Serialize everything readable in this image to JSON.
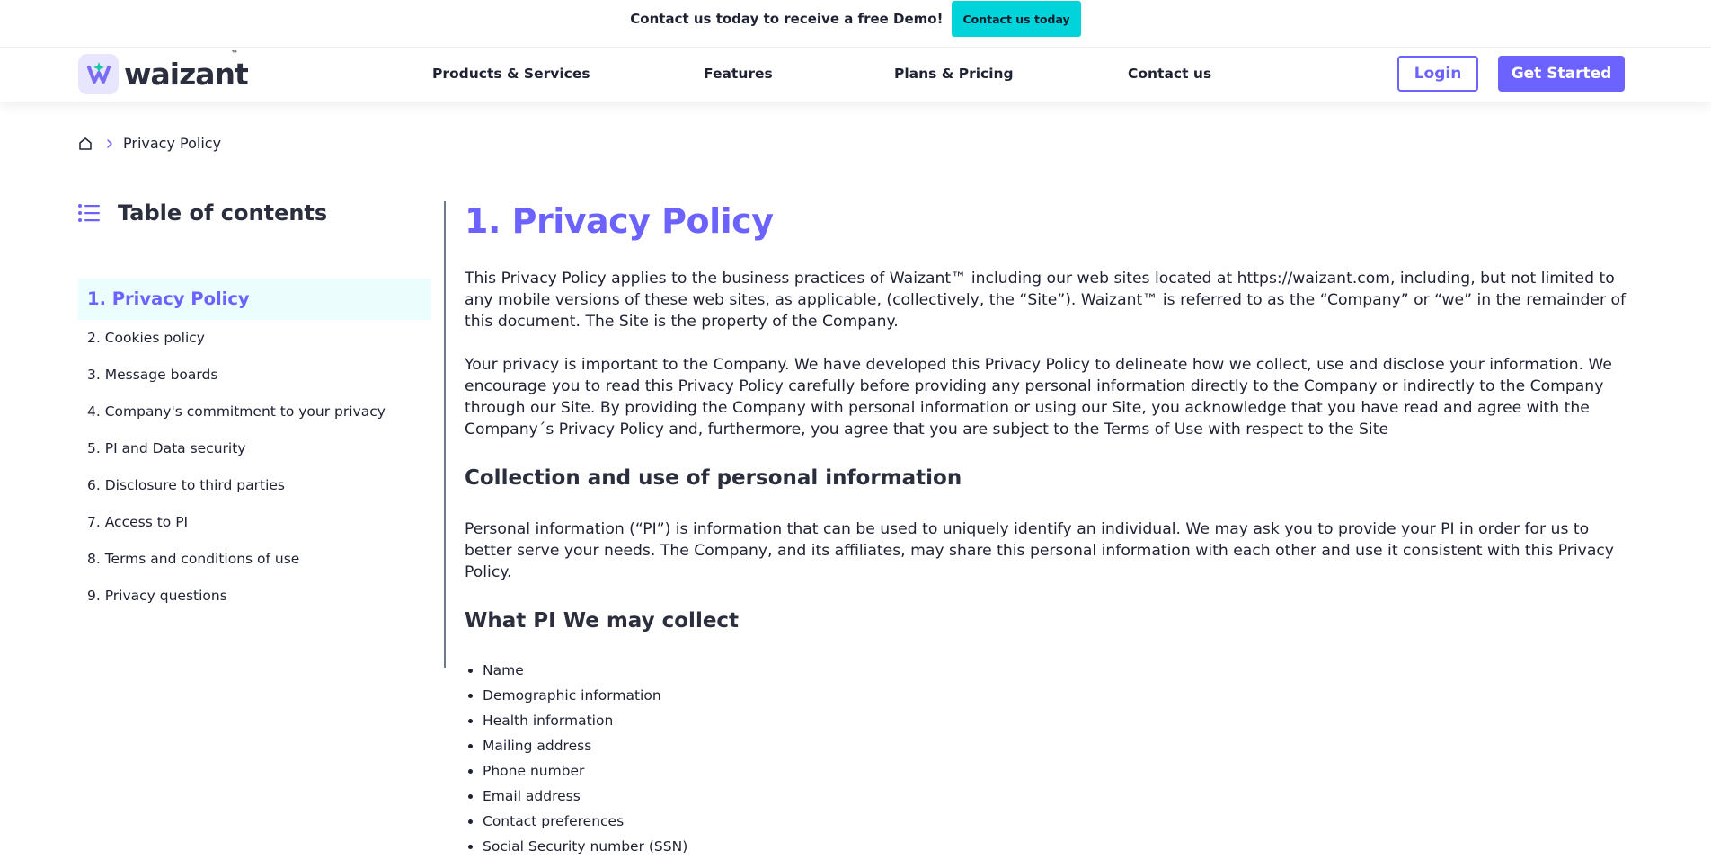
{
  "promo": {
    "text": "Contact us today to receive a free Demo!",
    "button": "Contact us today"
  },
  "header": {
    "logo_text": "waizant",
    "logo_tm": "™",
    "nav": [
      "Products & Services",
      "Features",
      "Plans & Pricing",
      "Contact us"
    ],
    "login": "Login",
    "get_started": "Get Started"
  },
  "breadcrumb": {
    "current": "Privacy Policy"
  },
  "toc": {
    "title": "Table of contents",
    "items": [
      "1. Privacy Policy",
      "2. Cookies policy",
      "3. Message boards",
      "4. Company's commitment to your privacy",
      "5. PI and Data security",
      "6. Disclosure to third parties",
      "7. Access to PI",
      "8. Terms and conditions of use",
      "9. Privacy questions"
    ],
    "active_index": 0
  },
  "content": {
    "title": "1. Privacy Policy",
    "p1": "This Privacy Policy applies to the business practices of Waizant™ including our web sites located at https://waizant.com, including, but not limited to any mobile versions of these web sites, as applicable, (collectively, the “Site”). Waizant™ is referred to as the “Company” or “we” in the remainder of this document. The Site is the property of the Company.",
    "p2": "Your privacy is important to the Company. We have developed this Privacy Policy to delineate how we collect, use and disclose your information. We encourage you to read this Privacy Policy carefully before providing any personal information directly to the Company or indirectly to the Company through our Site. By providing the Company with personal information or using our Site, you acknowledge that you have read and agree with the Company´s Privacy Policy and, furthermore, you agree that you are subject to the Terms of Use with respect to the Site",
    "h2a": "Collection and use of personal information",
    "p3": "Personal information (“PI”) is information that can be used to uniquely identify an individual. We may ask you to provide your PI in order for us to better serve your needs. The Company, and its affiliates, may share this personal information with each other and use it consistent with this Privacy Policy.",
    "h2b": "What PI We may collect",
    "bullets": [
      "Name",
      "Demographic information",
      "Health information",
      "Mailing address",
      "Phone number",
      "Email address",
      "Contact preferences",
      "Social Security number (SSN)"
    ]
  },
  "colors": {
    "accent": "#6c63ff",
    "promo_button": "#00d4db",
    "active_toc_bg": "#ebfdfd"
  }
}
